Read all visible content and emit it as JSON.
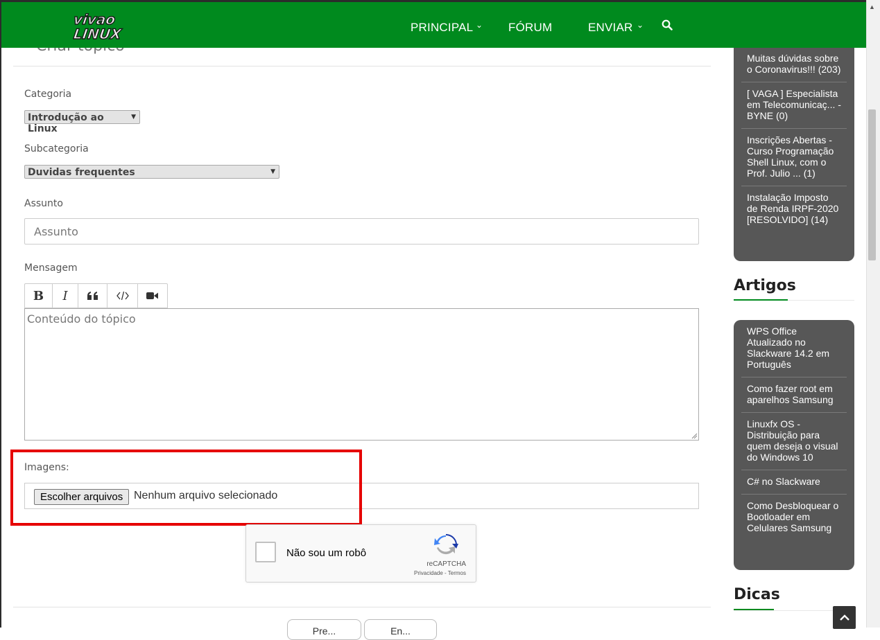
{
  "header": {
    "logo_alt": "Viva o Linux",
    "nav": [
      {
        "label": "PRINCIPAL",
        "has_caret": true
      },
      {
        "label": "FÓRUM",
        "has_caret": false
      },
      {
        "label": "ENVIAR",
        "has_caret": true
      }
    ],
    "search_icon": "search-icon",
    "bg_color": "#008a1e"
  },
  "form": {
    "title": "Criar tópico",
    "category_label": "Categoria",
    "category_value": "Introdução ao Linux",
    "subcategory_label": "Subcategoria",
    "subcategory_value": "Duvidas frequentes",
    "subject_label": "Assunto",
    "subject_placeholder": "Assunto",
    "message_label": "Mensagem",
    "toolbar": [
      {
        "name": "bold-button",
        "glyph": "B"
      },
      {
        "name": "italic-button",
        "glyph": "I"
      },
      {
        "name": "quote-button",
        "glyph": "quote-icon"
      },
      {
        "name": "code-button",
        "glyph": "code-icon"
      },
      {
        "name": "video-button",
        "glyph": "video-icon"
      }
    ],
    "message_placeholder": "Conteúdo do tópico",
    "images_label": "Imagens:",
    "file_button": "Escolher arquivos",
    "file_status": "Nenhum arquivo selecionado",
    "highlight_color": "#e60000"
  },
  "captcha": {
    "label": "Não sou um robô",
    "brand": "reCAPTCHA",
    "links": "Privacidade - Termos"
  },
  "bottom_buttons": [
    {
      "label": "Pre..."
    },
    {
      "label": "En..."
    }
  ],
  "sidebar": {
    "topics": [
      "Muitas dúvidas sobre o Coronavirus!!! (203)",
      "[ VAGA ] Especialista em Telecomunicaç... - BYNE (0)",
      "Inscrições Abertas - Curso Programação Shell Linux, com o Prof. Julio ... (1)",
      "Instalação Imposto de Renda IRPF-2020 [RESOLVIDO] (14)"
    ],
    "articles_heading": "Artigos",
    "articles": [
      "WPS Office Atualizado no Slackware 14.2 em Português",
      "Como fazer root em aparelhos Samsung",
      "Linuxfx OS - Distribuição para quem deseja o visual do Windows 10",
      "C# no Slackware",
      "Como Desbloquear o Bootloader em Celulares Samsung"
    ],
    "tips_heading": "Dicas"
  }
}
